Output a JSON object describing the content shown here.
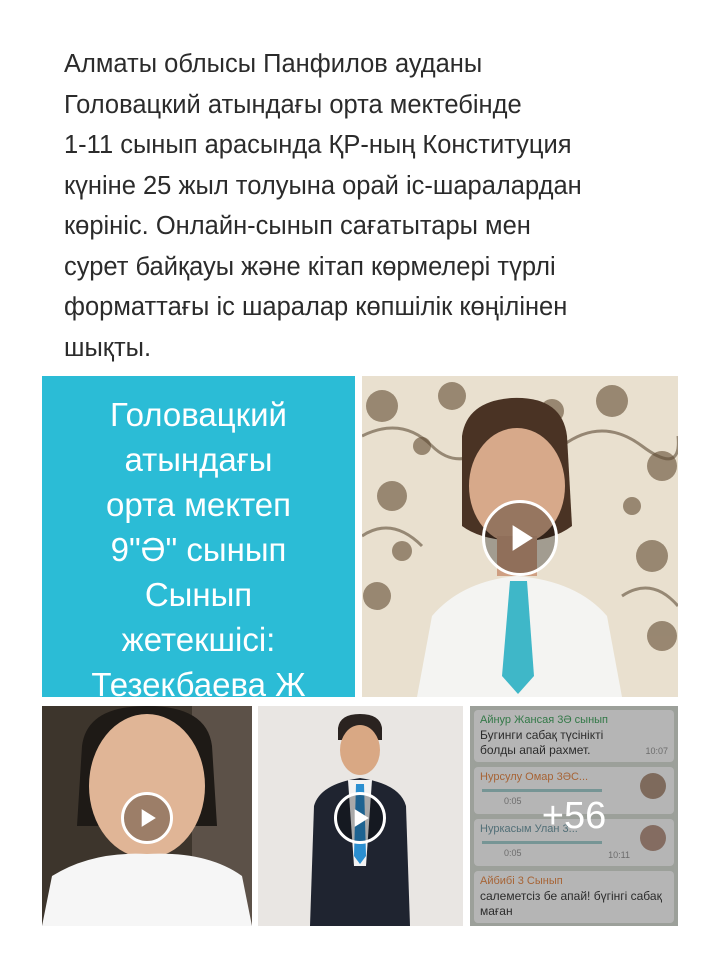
{
  "post": {
    "text": "Алматы облысы Панфилов ауданы\nГоловацкий  атындағы орта мектебінде\n1-11 сынып арасында ҚР-ның Конституция\nкүніне 25 жыл толуына орай іс-шаралардан\nкөрініс. Онлайн-сынып сағатытары мен\nсурет байқауы және кітап көрмелері түрлі\nформаттағы іс шаралар көпшілік көңілінен\nшықты."
  },
  "gallery": {
    "caption_tile": {
      "text": "Головацкий\nатындағы\nорта мектеп\n9\"Ә\" сынып\nСынып\nжетекшісі:\nТезекбаева Ж",
      "background": "#2bbcd6"
    },
    "more_count": "+56",
    "chat": {
      "messages": [
        {
          "sender": "Айнур Жансая 3Ә сынып",
          "text": "Бугинги сабақ түсінікті болды апай рахмет.",
          "time": "10:07"
        },
        {
          "sender": "Нурсулу Омар 3ӘС...",
          "duration": "0:05",
          "type": "voice"
        },
        {
          "sender": "Нуркасым Улан 3...",
          "duration": "0:05",
          "time": "10:11",
          "type": "voice"
        },
        {
          "sender": "Айбибі 3 Сынып",
          "text": "салеметсіз бе апай! бүгінгі сабақ маған"
        }
      ]
    }
  },
  "icons": {
    "play": "play-icon"
  }
}
